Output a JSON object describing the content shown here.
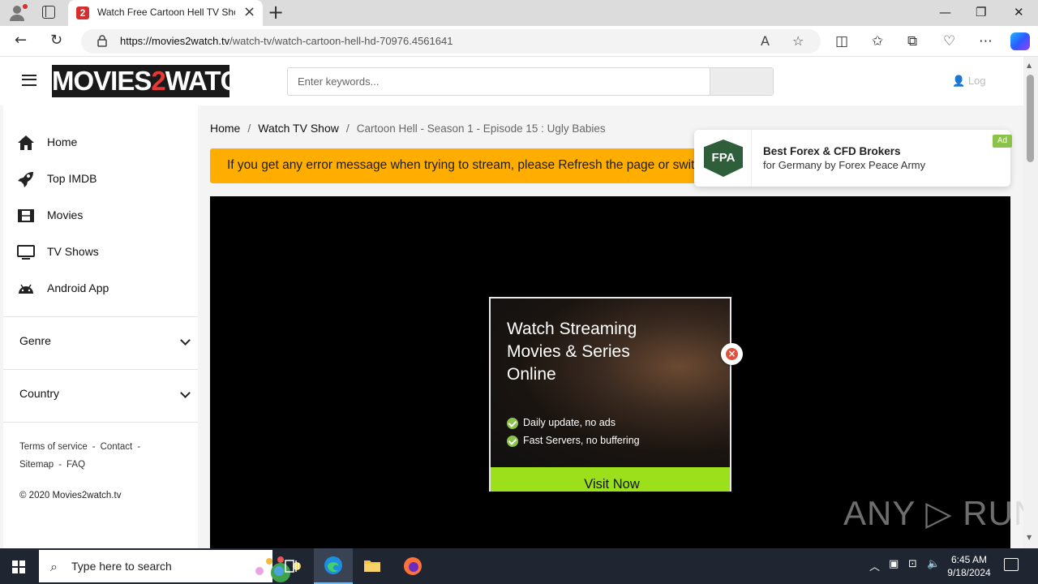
{
  "browser": {
    "tab_title": "Watch Free Cartoon Hell TV Shows",
    "url_host": "https://movies2watch.tv",
    "url_path": "/watch-tv/watch-cartoon-hell-hd-70976.4561641",
    "win_minimize": "—",
    "win_restore": "❐",
    "win_close": "✕"
  },
  "header": {
    "logo_left": "MOVIES",
    "logo_mid": "2",
    "logo_right": "WATCH",
    "search_placeholder": "Enter keywords...",
    "login_label": "Log"
  },
  "sidebar": {
    "items": [
      {
        "label": "Home",
        "icon": "home-icon"
      },
      {
        "label": "Top IMDB",
        "icon": "rocket-icon"
      },
      {
        "label": "Movies",
        "icon": "film-icon"
      },
      {
        "label": "TV Shows",
        "icon": "tv-icon"
      },
      {
        "label": "Android App",
        "icon": "android-icon"
      }
    ],
    "genre_label": "Genre",
    "country_label": "Country",
    "links": {
      "terms": "Terms of service",
      "contact": "Contact",
      "sitemap": "Sitemap",
      "faq": "FAQ",
      "dash": "-"
    },
    "copyright": "© 2020 Movies2watch.tv"
  },
  "breadcrumb": {
    "home": "Home",
    "sep": "/",
    "tv": "Watch TV Show",
    "current": "Cartoon Hell - Season 1 - Episode 15 : Ugly Babies"
  },
  "alert": {
    "text": "If you get any error message when trying to stream, please Refresh the page or switch to another streaming server."
  },
  "popup_ad": {
    "title": "Watch Streaming Movies & Series Online",
    "feature_1": "Daily update, no ads",
    "feature_2": "Fast Servers, no buffering",
    "button": "Visit Now",
    "close": "×"
  },
  "forex_ad": {
    "logo": "FPA",
    "title": "Best Forex & CFD Brokers",
    "subtitle": "for Germany by Forex Peace Army",
    "badge": "Ad"
  },
  "watermark": "ANY ▷ RUN",
  "taskbar": {
    "search_placeholder": "Type here to search",
    "time": "6:45 AM",
    "date": "9/18/2024"
  },
  "colors": {
    "alert": "#ffae00",
    "logo_accent": "#e53935",
    "visit_button": "#9be01a",
    "taskbar": "#1f2531"
  }
}
